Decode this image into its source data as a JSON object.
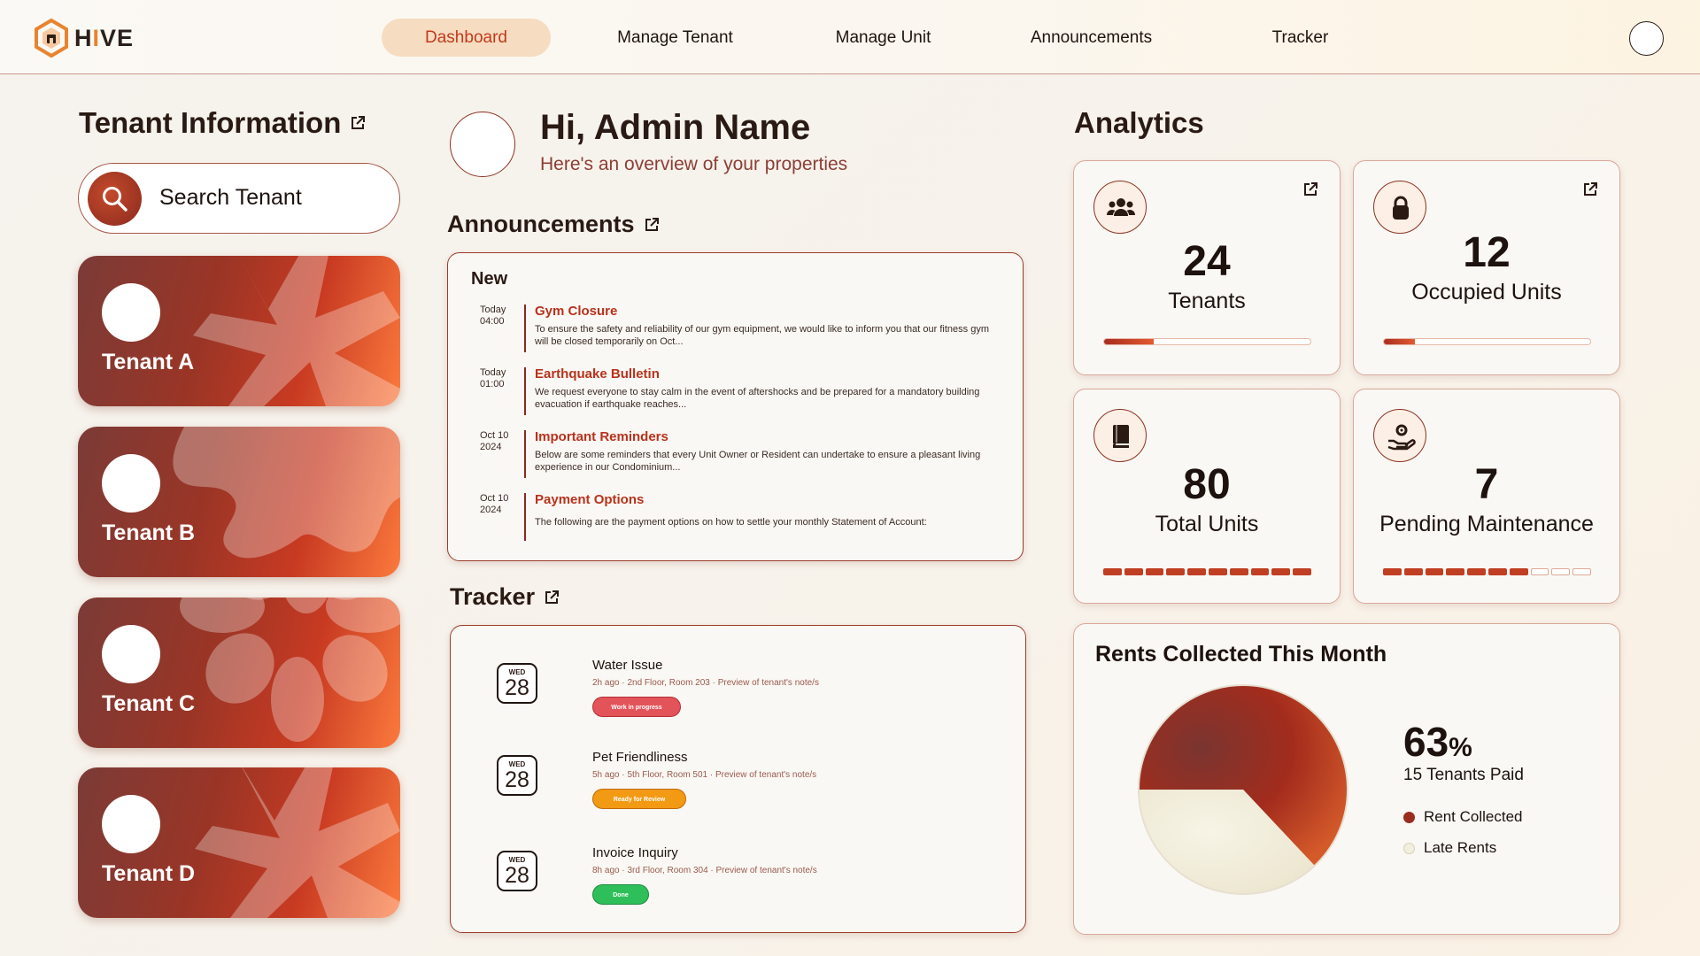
{
  "nav": {
    "logo": "HIVE",
    "items": [
      "Dashboard",
      "Manage Tenant",
      "Manage Unit",
      "Announcements",
      "Tracker"
    ],
    "active": "Dashboard"
  },
  "tenant_info": {
    "title": "Tenant Information",
    "search_placeholder": "Search Tenant",
    "tenants": [
      "Tenant A",
      "Tenant B",
      "Tenant C",
      "Tenant D"
    ]
  },
  "hero": {
    "greeting": "Hi, Admin Name",
    "subtitle": "Here's an overview of your properties"
  },
  "announcements": {
    "title": "Announcements",
    "section_label": "New",
    "items": [
      {
        "date_line1": "Today",
        "date_line2": "04:00",
        "title": "Gym Closure",
        "body": "To ensure the safety and reliability of our gym equipment, we would like to inform you that our fitness gym will be closed temporarily on Oct..."
      },
      {
        "date_line1": "Today",
        "date_line2": "01:00",
        "title": "Earthquake Bulletin",
        "body": "We request everyone to stay calm in the event of aftershocks and be prepared for a mandatory building evacuation if earthquake reaches..."
      },
      {
        "date_line1": "Oct 10",
        "date_line2": "2024",
        "title": "Important Reminders",
        "body": "Below are some reminders that every Unit Owner or Resident can undertake to ensure a pleasant living experience in our Condominium..."
      },
      {
        "date_line1": "Oct 10",
        "date_line2": "2024",
        "title": "Payment Options",
        "body": "The following are the payment options on how to settle your monthly Statement of Account:"
      }
    ]
  },
  "tracker": {
    "title": "Tracker",
    "items": [
      {
        "day": "WED",
        "date": "28",
        "title": "Water Issue",
        "meta": "2h ago  ·  2nd Floor, Room 203  ·  Preview of tenant's note/s",
        "status": "Work in progress",
        "status_color": "#e2545a"
      },
      {
        "day": "WED",
        "date": "28",
        "title": "Pet Friendliness",
        "meta": "5h ago  ·  5th Floor, Room 501  ·  Preview of tenant's note/s",
        "status": "Ready for Review",
        "status_color": "#f39a14"
      },
      {
        "day": "WED",
        "date": "28",
        "title": "Invoice Inquiry",
        "meta": "8h ago  ·  3rd Floor, Room 304  ·  Preview of tenant's note/s",
        "status": "Done",
        "status_color": "#2fbf5a"
      }
    ]
  },
  "analytics": {
    "title": "Analytics",
    "cards": [
      {
        "icon": "people-icon",
        "value": "24",
        "label": "Tenants",
        "progress": 0.24
      },
      {
        "icon": "lock-icon",
        "value": "12",
        "label": "Occupied Units",
        "progress": 0.15
      },
      {
        "icon": "book-icon",
        "value": "80",
        "label": "Total Units",
        "segments_filled": 10,
        "segments_total": 10
      },
      {
        "icon": "maintenance-icon",
        "value": "7",
        "label": "Pending Maintenance",
        "segments_filled": 7,
        "segments_total": 10
      }
    ]
  },
  "rents": {
    "title": "Rents Collected This Month",
    "percent": "63",
    "percent_unit": "%",
    "subtitle": "15 Tenants Paid",
    "legend": [
      "Rent Collected",
      "Late Rents"
    ],
    "chart_data": {
      "type": "pie",
      "categories": [
        "Rent Collected",
        "Late Rents"
      ],
      "values": [
        63,
        37
      ]
    },
    "colors": {
      "collected": "#9a2d1e",
      "late": "#f3efdf"
    }
  }
}
